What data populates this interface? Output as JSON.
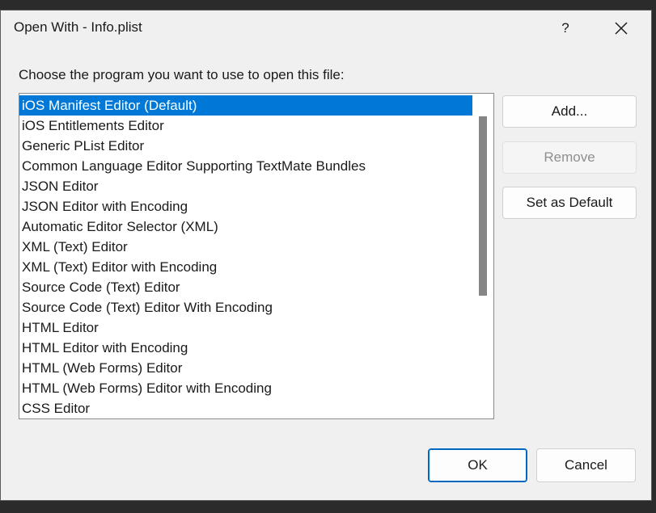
{
  "window": {
    "title": "Open With - Info.plist",
    "help_label": "?"
  },
  "prompt": "Choose the program you want to use to open this file:",
  "programs": [
    "iOS Manifest Editor (Default)",
    "iOS Entitlements Editor",
    "Generic PList Editor",
    "Common Language Editor Supporting TextMate Bundles",
    "JSON Editor",
    "JSON Editor with Encoding",
    "Automatic Editor Selector (XML)",
    "XML (Text) Editor",
    "XML (Text) Editor with Encoding",
    "Source Code (Text) Editor",
    "Source Code (Text) Editor With Encoding",
    "HTML Editor",
    "HTML Editor with Encoding",
    "HTML (Web Forms) Editor",
    "HTML (Web Forms) Editor with Encoding",
    "CSS Editor"
  ],
  "selected_index": 0,
  "side_buttons": {
    "add": "Add...",
    "remove": "Remove",
    "set_default": "Set as Default"
  },
  "footer": {
    "ok": "OK",
    "cancel": "Cancel"
  },
  "colors": {
    "selection": "#0078d7",
    "ok_border": "#0067c0"
  }
}
